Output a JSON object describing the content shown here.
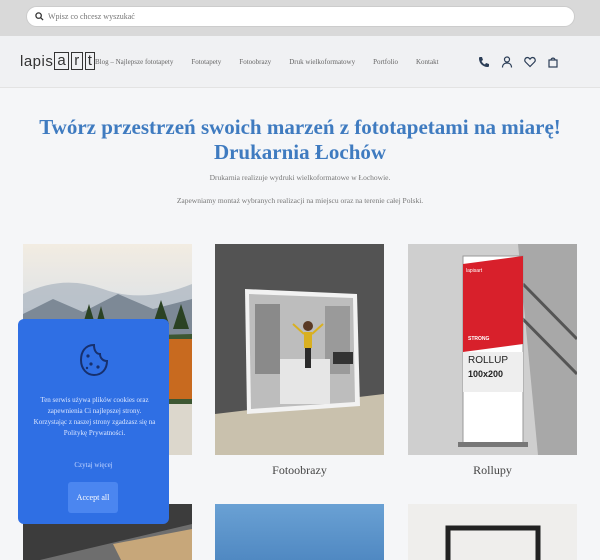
{
  "search": {
    "placeholder": "Wpisz co chcesz wyszukać"
  },
  "logo": {
    "parts": [
      "lapis",
      "a",
      "r",
      "t"
    ]
  },
  "nav": [
    "Blog – Najlepsze fototapety",
    "Fototapety",
    "Fotoobrazy",
    "Druk wielkoformatowy",
    "Portfolio",
    "Kontakt"
  ],
  "icons": [
    "phone-icon",
    "user-icon",
    "heart-icon",
    "cart-icon"
  ],
  "hero": {
    "title": "Twórz przestrzeń swoich marzeń z fototapetami na miarę! Drukarnia Łochów",
    "p1": "Drukarnia realizuje wydruki wielkoformatowe w Łochowie.",
    "p2": "Zapewniamy montaż wybranych realizacji na miejscu oraz na terenie całej Polski."
  },
  "cards": [
    {
      "label": ""
    },
    {
      "label": "Fotoobrazy"
    },
    {
      "label": "Rollupy"
    }
  ],
  "rollup": {
    "brand": "lapisart",
    "strong": "STRONG",
    "title": "ROLLUP",
    "size": "100x200"
  },
  "cookie": {
    "text": "Ten serwis używa plików cookies oraz zapewnienia Ci najlepszej strony. Korzystając z naszej strony zgadzasz się na Politykę Prywatności.",
    "link": "Czytaj więcej",
    "accept": "Accept all"
  },
  "colors": {
    "accent": "#3f7bc0",
    "cookie_bg": "#2f6fe4",
    "button": "#4b86f0"
  }
}
